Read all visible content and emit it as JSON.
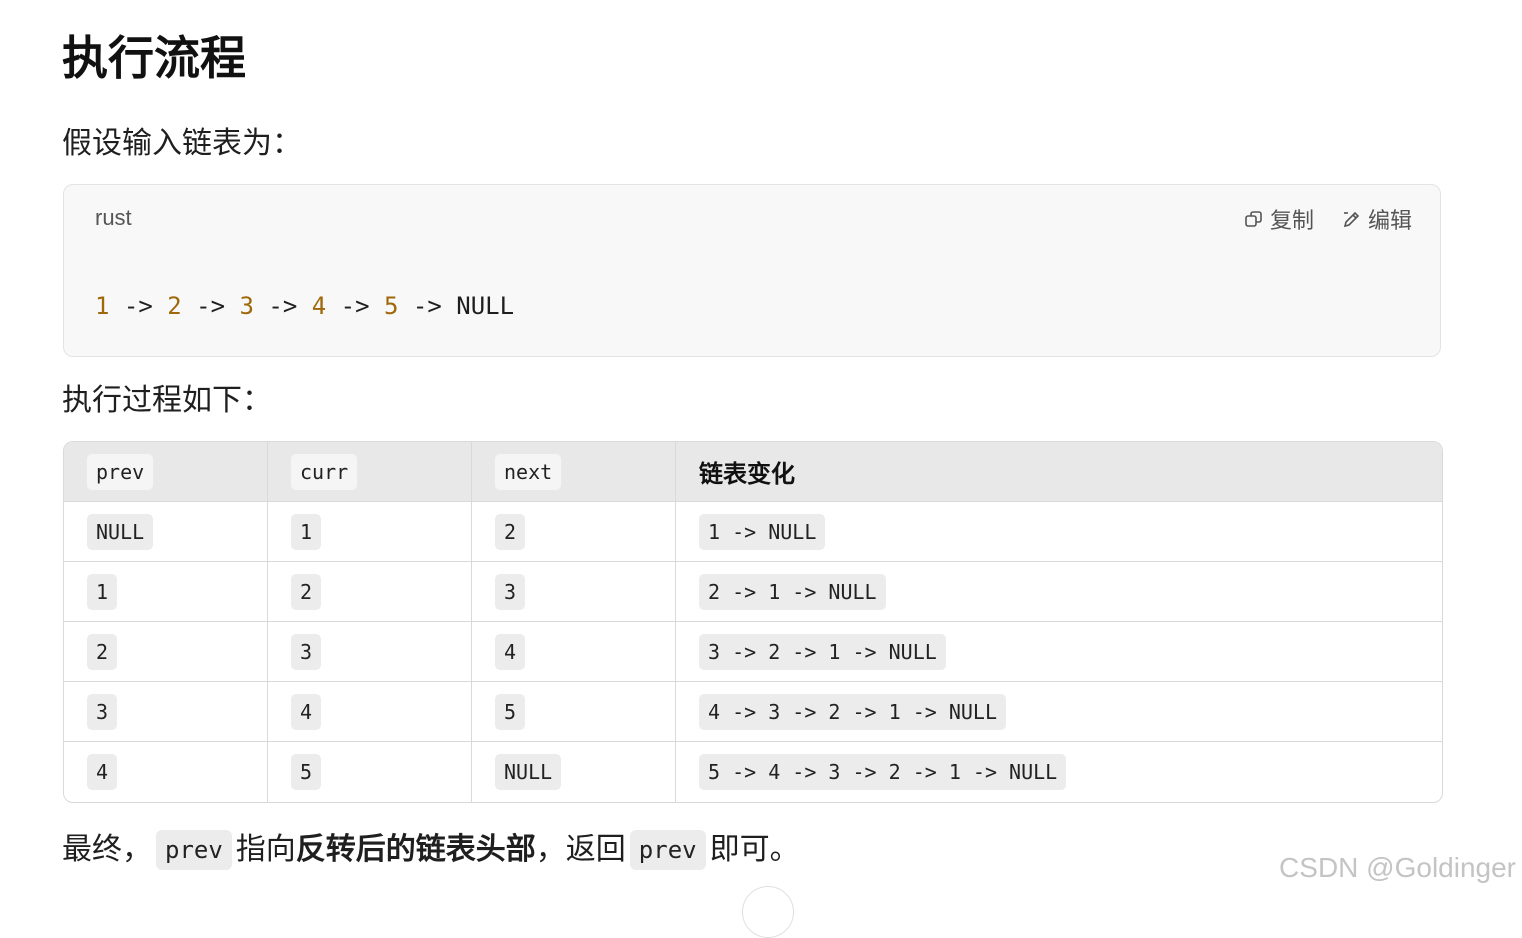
{
  "heading": "执行流程",
  "intro_text": "假设输入链表为：",
  "code": {
    "language": "rust",
    "copy_label": "复制",
    "edit_label": "编辑",
    "tokens": [
      "1",
      " -> ",
      "2",
      " -> ",
      "3",
      " -> ",
      "4",
      " -> ",
      "5",
      " -> NULL"
    ]
  },
  "process_text": "执行过程如下：",
  "table": {
    "headers": [
      "prev",
      "curr",
      "next",
      "链表变化"
    ],
    "rows": [
      [
        "NULL",
        "1",
        "2",
        "1 -> NULL"
      ],
      [
        "1",
        "2",
        "3",
        "2 -> 1 -> NULL"
      ],
      [
        "2",
        "3",
        "4",
        "3 -> 2 -> 1 -> NULL"
      ],
      [
        "3",
        "4",
        "5",
        "4 -> 3 -> 2 -> 1 -> NULL"
      ],
      [
        "4",
        "5",
        "NULL",
        "5 -> 4 -> 3 -> 2 -> 1 -> NULL"
      ]
    ]
  },
  "conclusion": {
    "prefix": "最终，",
    "code1": "prev",
    "mid": "指向",
    "bold": "反转后的链表头部",
    "after_bold": "，返回",
    "code2": "prev",
    "suffix": "即可。"
  },
  "watermark": "CSDN @Goldinger",
  "colors": {
    "number_token": "#a0680a",
    "code_bg": "#f8f8f8",
    "table_header_bg": "#e8e8e8",
    "inline_code_bg": "#ececec"
  }
}
